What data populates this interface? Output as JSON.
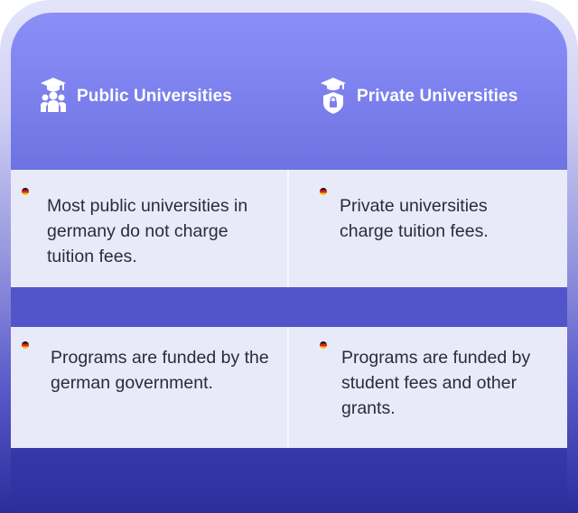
{
  "columns": {
    "public": {
      "title": "Public Universities",
      "icon": "graduation-people-icon"
    },
    "private": {
      "title": "Private Universities",
      "icon": "graduation-shield-lock-icon"
    }
  },
  "rows": [
    {
      "public": {
        "flag": "germany-flag-icon",
        "text_lines": [
          "Most public universities in",
          "germany do not charge",
          "tuition fees."
        ]
      },
      "private": {
        "flag": "germany-flag-icon",
        "text_lines": [
          "Private universities",
          "charge tuition fees."
        ]
      }
    },
    {
      "public": {
        "flag": "germany-flag-icon",
        "text_lines": [
          "Programs are funded by the",
          "german government."
        ]
      },
      "private": {
        "flag": "germany-flag-icon",
        "text_lines": [
          "Programs are funded by",
          "student fees and other",
          "grants."
        ]
      }
    }
  ],
  "colors": {
    "header_gradient_top": "#8a8ff7",
    "row_background": "#e9eaf9",
    "text": "#2b2b3a",
    "band": "#5254c9"
  }
}
